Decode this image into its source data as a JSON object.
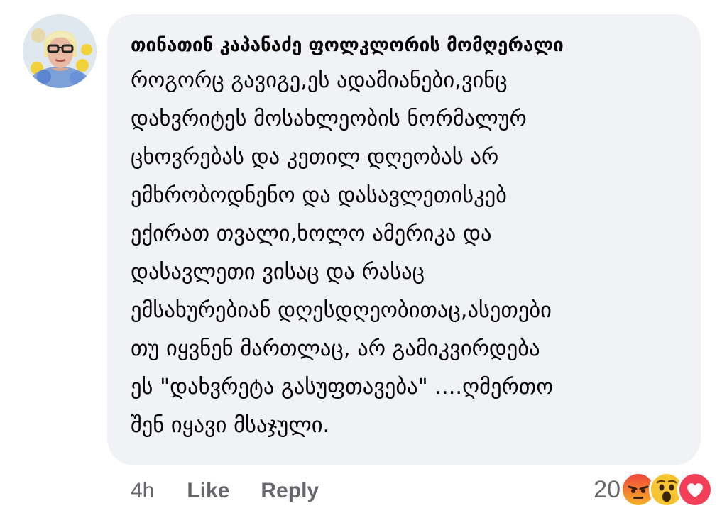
{
  "comment": {
    "author": "თინათინ კაპანაძე ფოლკლორის მომღერალი",
    "text": "როგორც გავიგე,ეს ადამიანები,ვინც\nდახვრიტეს მოსახლეობის ნორმალურ\nცხოვრებას და კეთილ დღეობას არ\nემხრობოდნენო და დასავლეთისკებ\nექირათ თვალი,ხოლო ამერიკა და\nდასავლეთი ვისაც და რასაც\nემსახურებიან დღესდღეობითაც,ასეთები\nთუ იყვნენ მართლაც, არ გამიკვირდება\nეს \"დახვრეტა გასუფთავება\" ....ღმერთო\nშენ იყავი მსაჯული.",
    "time": "4h",
    "like_label": "Like",
    "reply_label": "Reply",
    "reaction_count": "20",
    "reactions": [
      "angry-reaction-icon",
      "wow-reaction-icon",
      "love-reaction-icon"
    ]
  },
  "colors": {
    "bubble": "#f0f2f5",
    "text": "#050505",
    "meta": "#65676b",
    "love": "#f33e58",
    "angry": "#e9710f",
    "wow": "#f7b125"
  }
}
